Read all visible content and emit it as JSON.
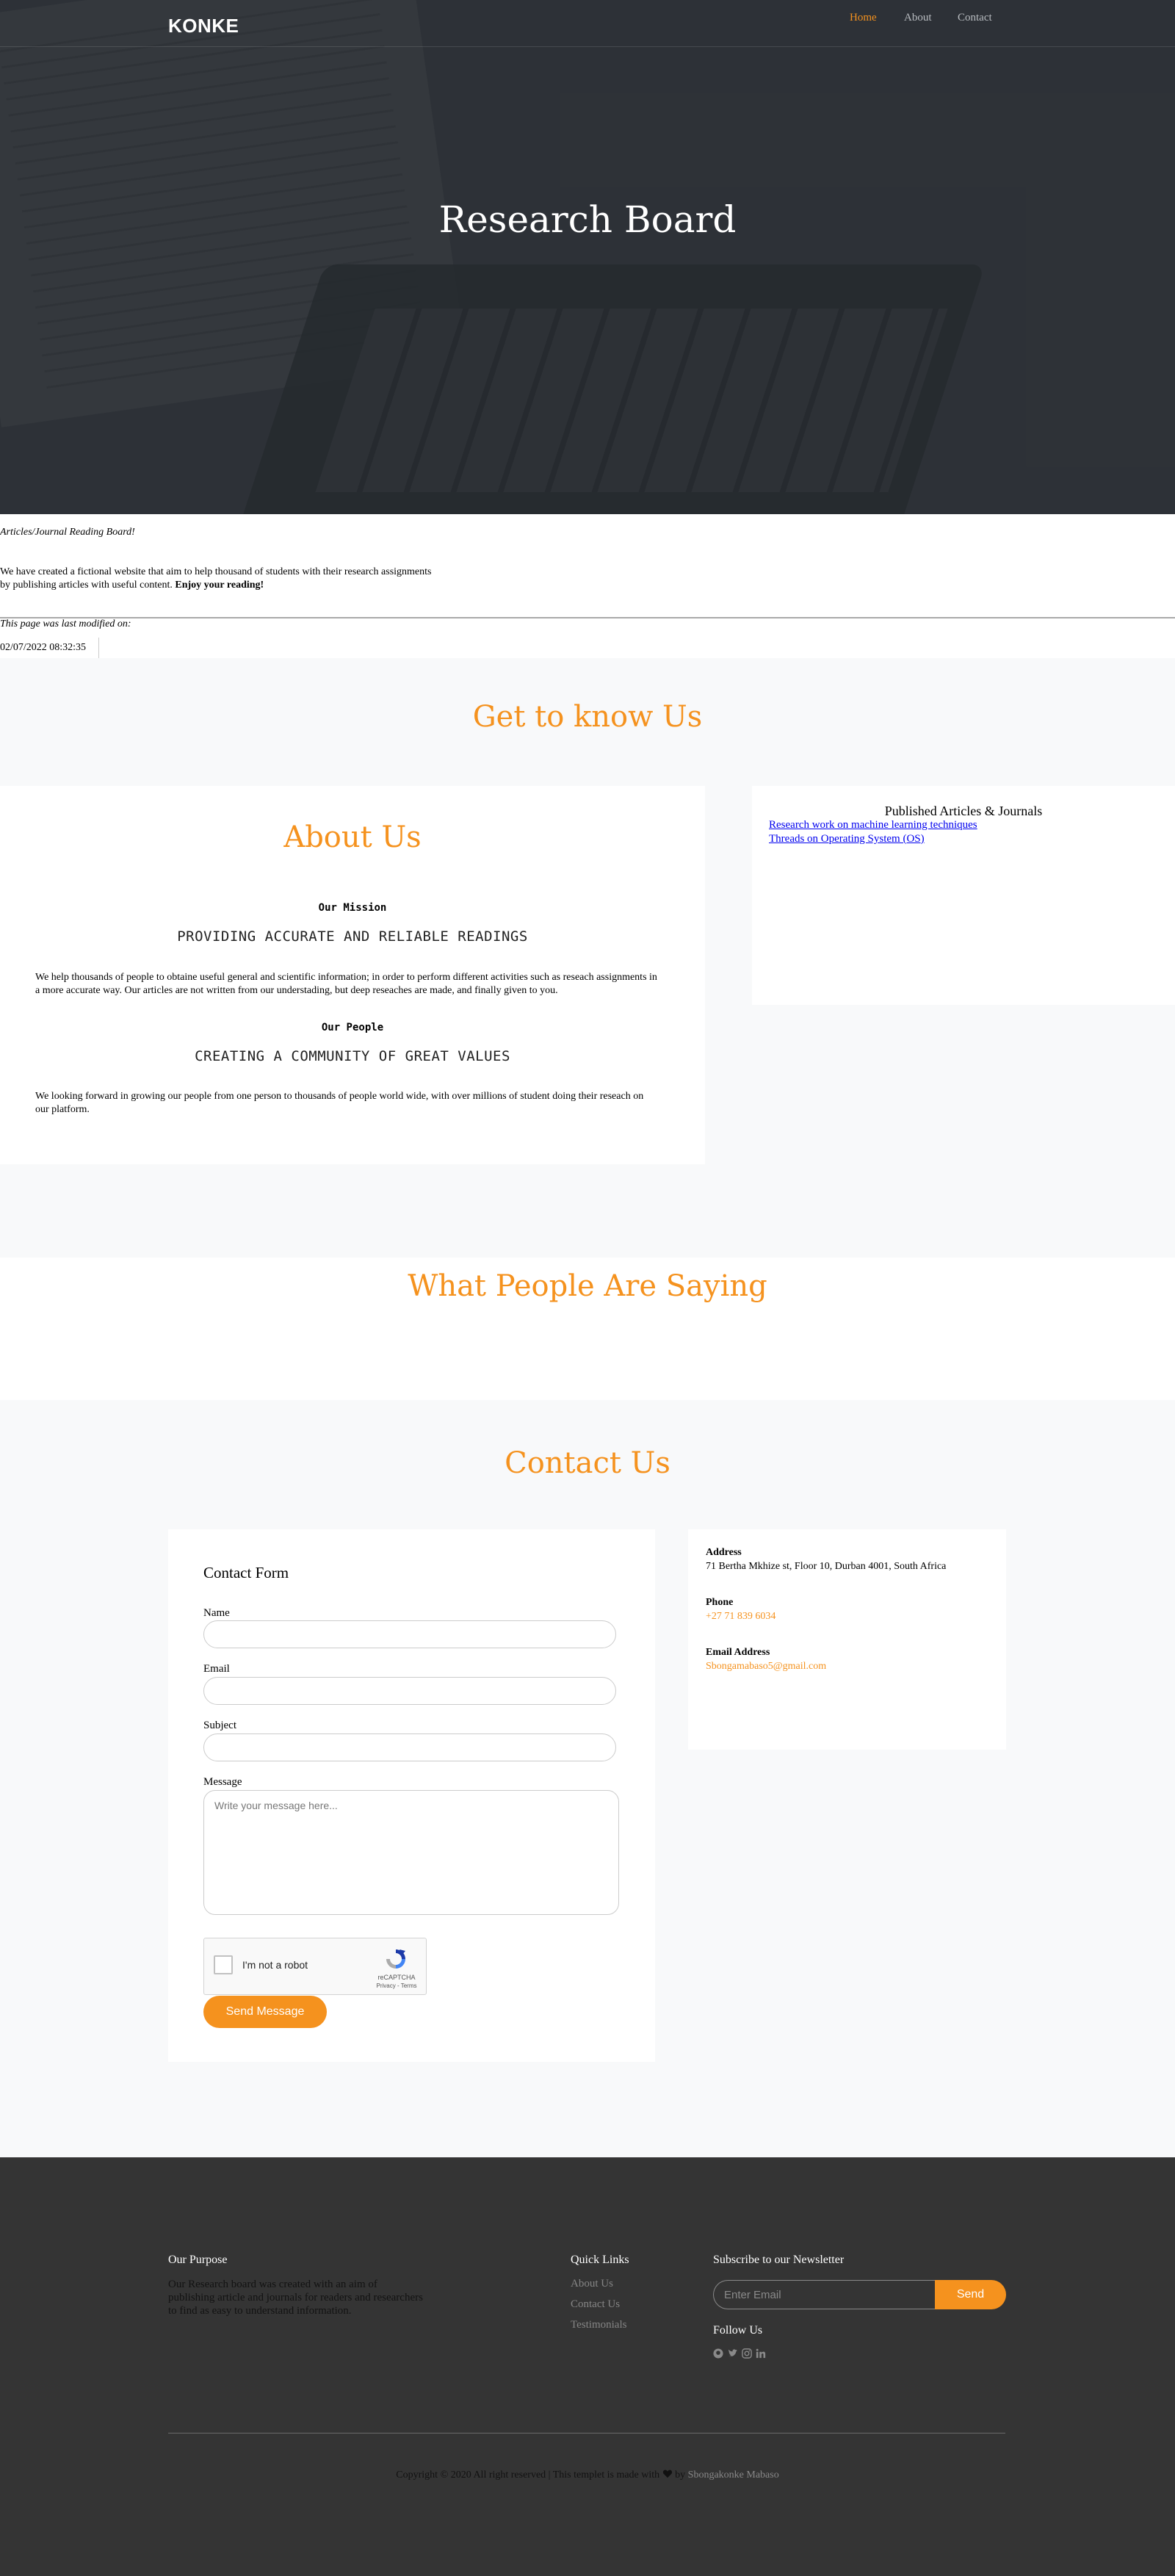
{
  "brand": "KONKE",
  "nav": {
    "home": "Home",
    "about": "About",
    "contact": "Contact"
  },
  "hero": {
    "title": "Research Board"
  },
  "intro": {
    "tagline": "Articles/Journal Reading Board!",
    "desc": "We have created a fictional website that aim to help thousand of students with their research assignments by publishing articles with useful content.",
    "desc_bold": "Enjoy your reading!",
    "modified_label": "This page was last modified on:",
    "modified_value": "02/07/2022 08:32:35"
  },
  "get_to_know": {
    "title": "Get to know Us"
  },
  "about": {
    "title": "About Us",
    "mission_label": "Our Mission",
    "mission_heading": "PROVIDING ACCURATE AND RELIABLE READINGS",
    "mission_text": "We help thousands of people to obtaine useful general and scientific information; in order to perform different activities such as reseach assignments in a more accurate way. Our articles are not written from our understading, but deep reseaches are made, and finally given to you.",
    "people_label": "Our People",
    "people_heading": "CREATING A COMMUNITY OF GREAT VALUES",
    "people_text": "We looking forward in growing our people from one person to thousands of people world wide, with over millions of student doing their reseach on our platform."
  },
  "articles": {
    "title": "Published Articles & Journals",
    "links": [
      "Research work on machine learning techniques",
      "Threads on Operating System (OS)"
    ]
  },
  "testimonials": {
    "title": "What People Are Saying"
  },
  "contact": {
    "title": "Contact Us",
    "form_title": "Contact Form",
    "name_label": "Name",
    "email_label": "Email",
    "subject_label": "Subject",
    "message_label": "Message",
    "message_placeholder": "Write your message here...",
    "captcha_text": "I'm not a robot",
    "captcha_brand": "reCAPTCHA",
    "captcha_terms": "Privacy - Terms",
    "send_label": "Send Message",
    "address_label": "Address",
    "address_value": "71 Bertha Mkhize st, Floor 10, Durban 4001, South Africa",
    "phone_label": "Phone",
    "phone_value": "+27 71 839 6034",
    "email_address_label": "Email Address",
    "email_address_value": "Sbongamabaso5@gmail.com"
  },
  "footer": {
    "purpose_title": "Our Purpose",
    "purpose_text": "Our Research board was created with an aim of publishing article and journals for readers and researchers to find as easy to understand information.",
    "quick_links_title": "Quick Links",
    "quick_links": [
      "About Us",
      "Contact Us",
      "Testimonials"
    ],
    "newsletter_title": "Subscribe to our Newsletter",
    "newsletter_placeholder": "Enter Email",
    "newsletter_button": "Send",
    "follow_title": "Follow Us",
    "social_icons": [
      "github-icon",
      "twitter-icon",
      "instagram-icon",
      "linkedin-icon"
    ],
    "copyright_prefix": "Copyright © 2020 All right reserved | This templet is made with",
    "copyright_by": "by",
    "author": "Sbongakonke Mabaso"
  },
  "colors": {
    "accent": "#f5921e",
    "footer_bg": "#343434",
    "hero_overlay": "#3d4247",
    "section_grey": "#f8f9fa"
  }
}
